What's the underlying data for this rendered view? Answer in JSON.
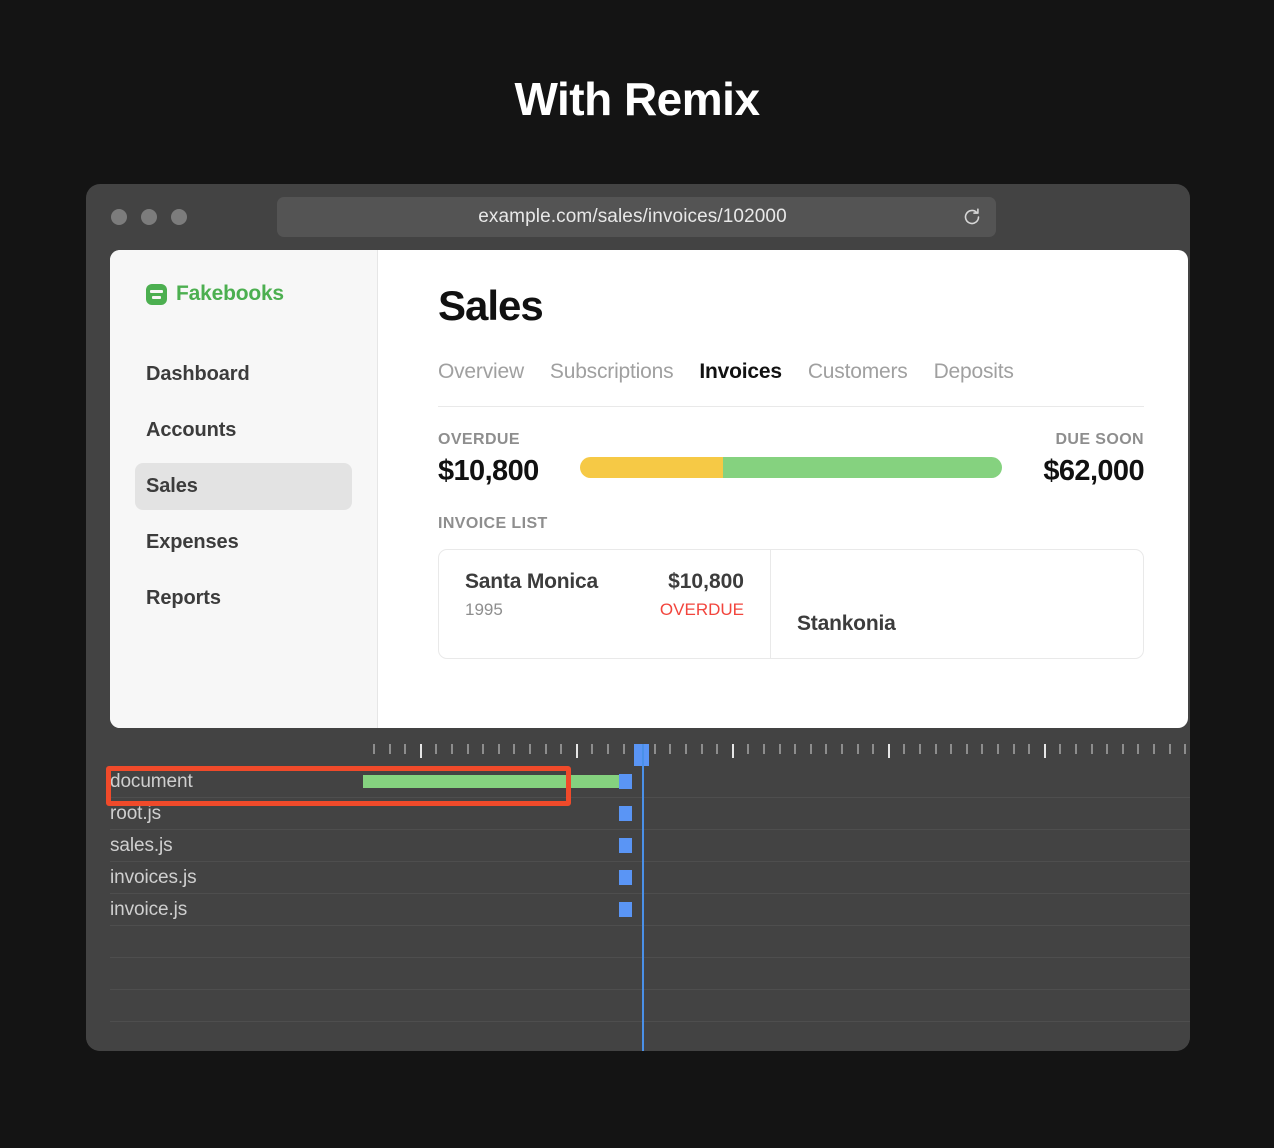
{
  "page": {
    "heading": "With Remix",
    "background_color": "#141414"
  },
  "browser": {
    "url": "example.com/sales/invoices/102000",
    "reload_icon": "reload-icon",
    "traffic_lights": [
      "close-dot",
      "minimize-dot",
      "maximize-dot"
    ]
  },
  "app": {
    "brand": {
      "name": "Fakebooks",
      "icon": "fakebooks-logo-icon",
      "color": "#4caf50"
    },
    "sidebar": {
      "items": [
        {
          "label": "Dashboard",
          "active": false
        },
        {
          "label": "Accounts",
          "active": false
        },
        {
          "label": "Sales",
          "active": true
        },
        {
          "label": "Expenses",
          "active": false
        },
        {
          "label": "Reports",
          "active": false
        }
      ]
    },
    "main": {
      "title": "Sales",
      "tabs": [
        {
          "label": "Overview",
          "active": false
        },
        {
          "label": "Subscriptions",
          "active": false
        },
        {
          "label": "Invoices",
          "active": true
        },
        {
          "label": "Customers",
          "active": false
        },
        {
          "label": "Deposits",
          "active": false
        }
      ],
      "totals": {
        "overdue_label": "OVERDUE",
        "overdue_value": "$10,800",
        "due_soon_label": "DUE SOON",
        "due_soon_value": "$62,000",
        "overdue_color": "#f6c945",
        "due_soon_color": "#85d27f",
        "overdue_pct": 34,
        "due_soon_pct": 66
      },
      "invoice_list_label": "INVOICE LIST",
      "invoices": [
        {
          "name": "Santa Monica",
          "amount": "$10,800",
          "sub": "1995",
          "status": "OVERDUE",
          "status_color": "#f2453d"
        },
        {
          "name": "Stankonia",
          "amount": "",
          "sub": "",
          "status": ""
        }
      ]
    }
  },
  "devtools": {
    "rows": [
      {
        "name": "document",
        "bar": true,
        "marker": true
      },
      {
        "name": "root.js",
        "bar": false,
        "marker": true
      },
      {
        "name": "sales.js",
        "bar": false,
        "marker": true
      },
      {
        "name": "invoices.js",
        "bar": false,
        "marker": true
      },
      {
        "name": "invoice.js",
        "bar": false,
        "marker": true
      },
      {
        "name": "",
        "bar": false,
        "marker": false
      },
      {
        "name": "",
        "bar": false,
        "marker": false
      },
      {
        "name": "",
        "bar": false,
        "marker": false
      }
    ],
    "highlighted_row": "document",
    "highlight_color": "#f04a2a",
    "bar_color": "#85d27f",
    "marker_color": "#5a95f5",
    "playhead_color": "#4a90e8"
  }
}
